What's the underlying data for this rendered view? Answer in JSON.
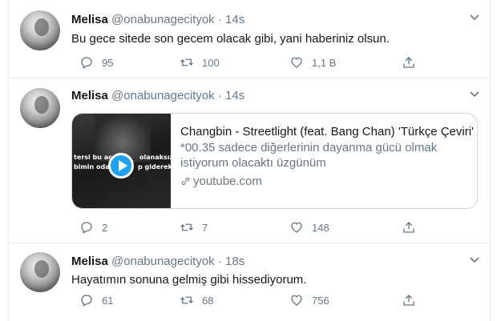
{
  "tweets": [
    {
      "name": "Melisa",
      "handle": "@onabunagecityok",
      "separator": "·",
      "time": "14s",
      "text": "Bu gece sitede son gecem olacak gibi, yani haberiniz olsun.",
      "replies": "95",
      "retweets": "100",
      "likes": "1,1 B"
    },
    {
      "name": "Melisa",
      "handle": "@onabunagecityok",
      "separator": "·",
      "time": "14s",
      "card": {
        "title": "Changbin - Streetlight (feat. Bang Chan) 'Türkçe Çeviri'",
        "description_line1": "*00.35 sadece diğerlerinin dayanma gücü olmak",
        "description_line2": "istiyorum olacaktı üzgünüm",
        "domain": "youtube.com",
        "thumb_caption_1": "tersi bu ac",
        "thumb_caption_2": "olanaksız",
        "thumb_caption_3": "bimin odas",
        "thumb_caption_4": "p giderek"
      },
      "replies": "2",
      "retweets": "7",
      "likes": "148"
    },
    {
      "name": "Melisa",
      "handle": "@onabunagecityok",
      "separator": "·",
      "time": "18s",
      "text": "Hayatımın sonuna gelmiş gibi hissediyorum.",
      "replies": "61",
      "retweets": "68",
      "likes": "756"
    }
  ],
  "icons": {
    "reply": "reply-icon",
    "retweet": "retweet-icon",
    "like": "heart-icon",
    "share": "share-icon",
    "more": "chevron-down-icon",
    "link": "link-icon"
  },
  "colors": {
    "text": "#14171a",
    "secondary": "#657786",
    "border": "#e6ecf0",
    "accent": "#1da1f2"
  }
}
